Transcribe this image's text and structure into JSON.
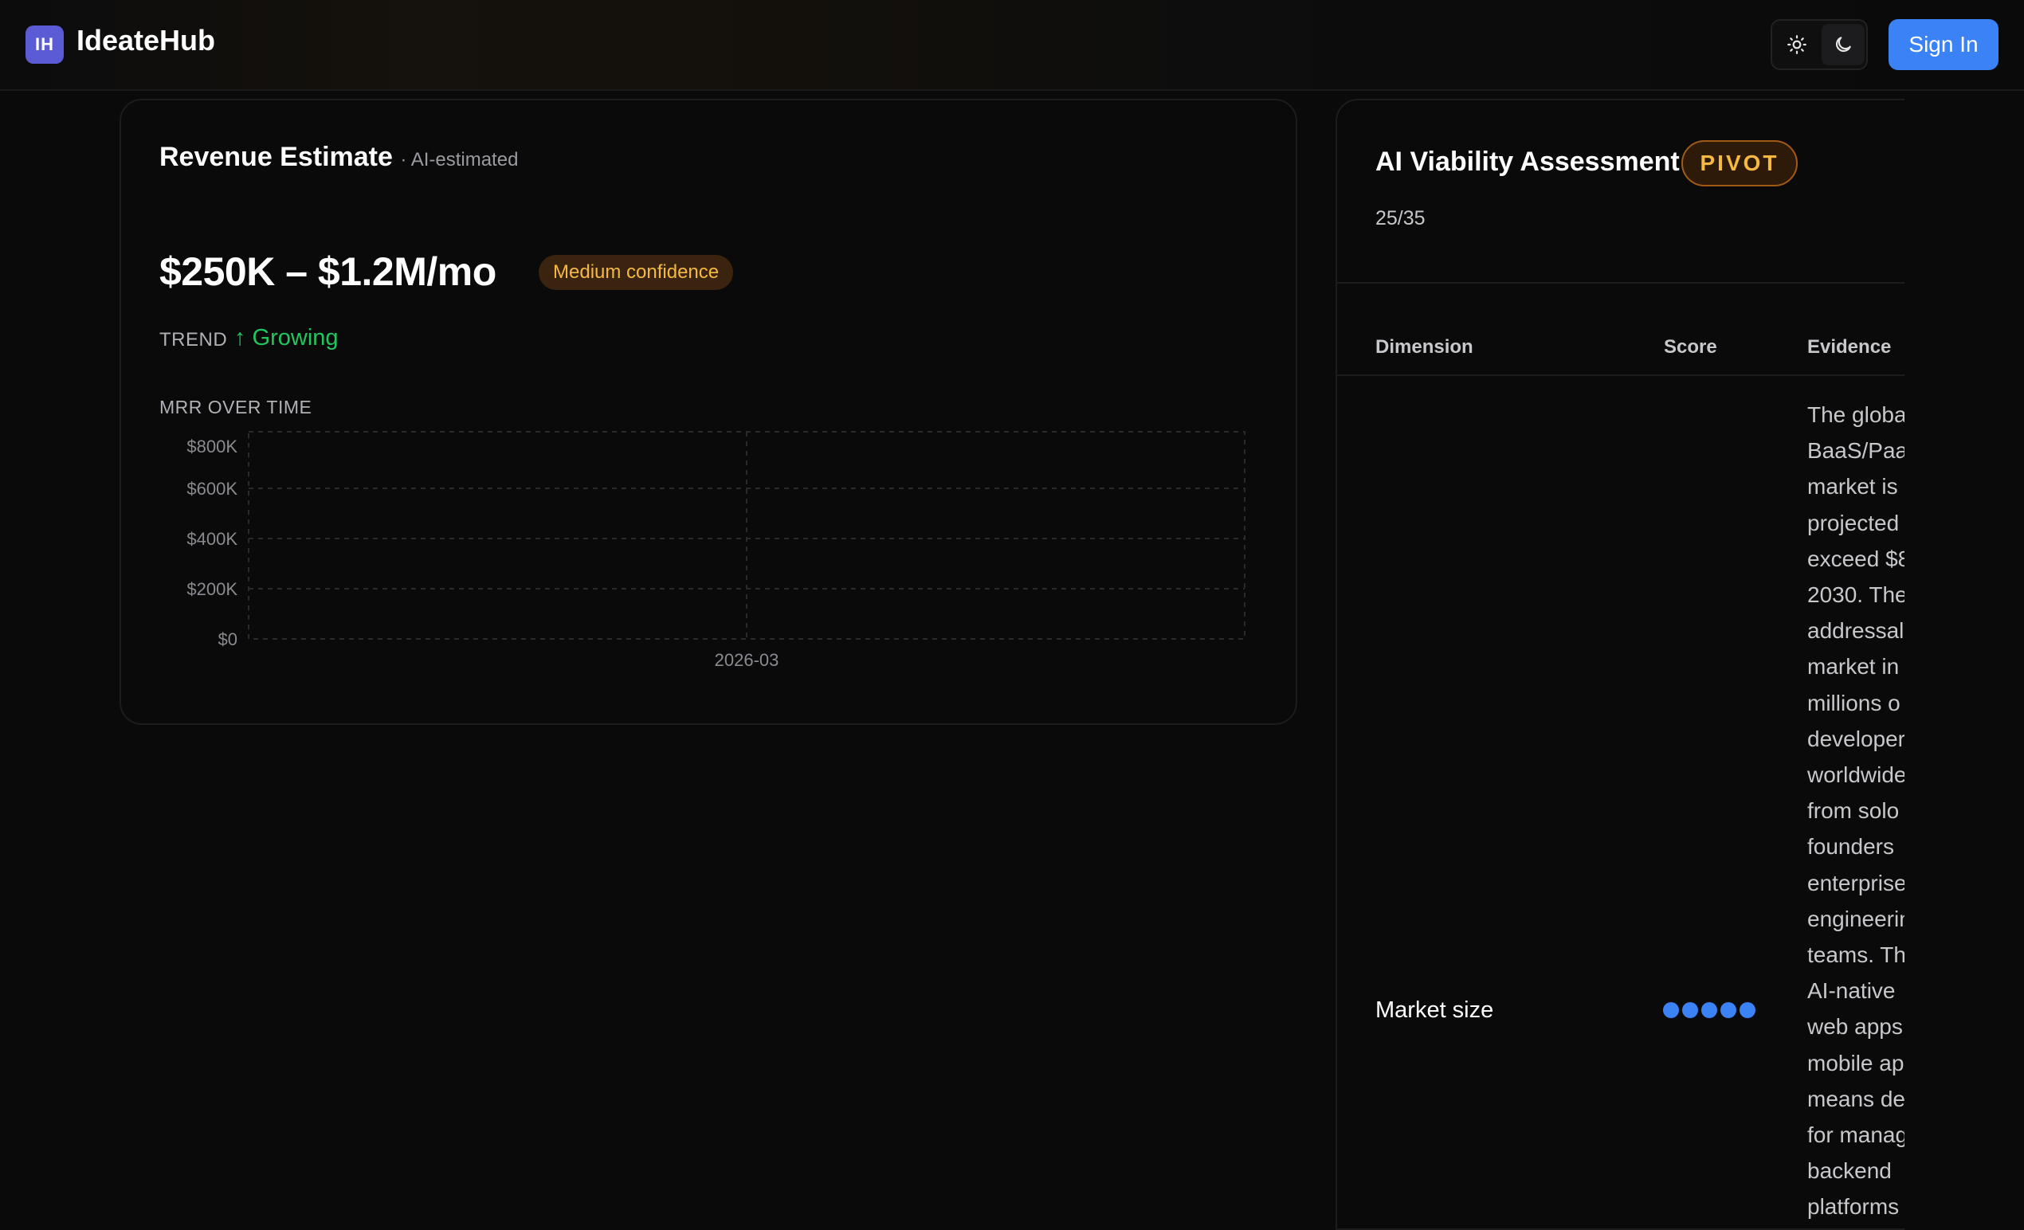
{
  "header": {
    "logo_initials": "IH",
    "brand_name": "IdeateHub",
    "sign_in_label": "Sign In",
    "theme_icons": [
      "sun-icon",
      "moon-icon"
    ]
  },
  "revenue": {
    "title": "Revenue Estimate",
    "subtitle": "· AI-estimated",
    "range": "$250K – $1.2M/mo",
    "confidence": "Medium confidence",
    "trend_label": "TREND",
    "trend_value": "↑ Growing",
    "chart_label": "MRR OVER TIME"
  },
  "chart_data": {
    "type": "line",
    "title": "MRR OVER TIME",
    "x": [
      "2026-03"
    ],
    "series": [],
    "y_ticks": [
      "$0",
      "$200K",
      "$400K",
      "$600K",
      "$800K"
    ],
    "ylim": [
      0,
      800000
    ],
    "grid": true
  },
  "viability": {
    "title": "AI Viability Assessment",
    "verdict": "PIVOT",
    "score": "25/35",
    "columns": {
      "dimension": "Dimension",
      "score": "Score",
      "evidence": "Evidence"
    },
    "rows": [
      {
        "dimension": "Market size",
        "score": 5,
        "evidence_lines": [
          "The globa",
          "BaaS/Paa",
          "market is",
          "projected",
          "exceed $8",
          "2030. The",
          "addressal",
          "market in",
          "millions o",
          "developer",
          "worldwide",
          "from solo",
          "founders",
          "enterprise",
          "engineerin",
          "teams. Th",
          "AI-native",
          "web apps",
          "mobile ap",
          "means de",
          "for manag",
          "backend",
          "platforms"
        ]
      }
    ]
  },
  "colors": {
    "accent": "#3b82f6",
    "growth": "#22c55e",
    "warning": "#f5b942",
    "logo": "#5b5bd6"
  }
}
